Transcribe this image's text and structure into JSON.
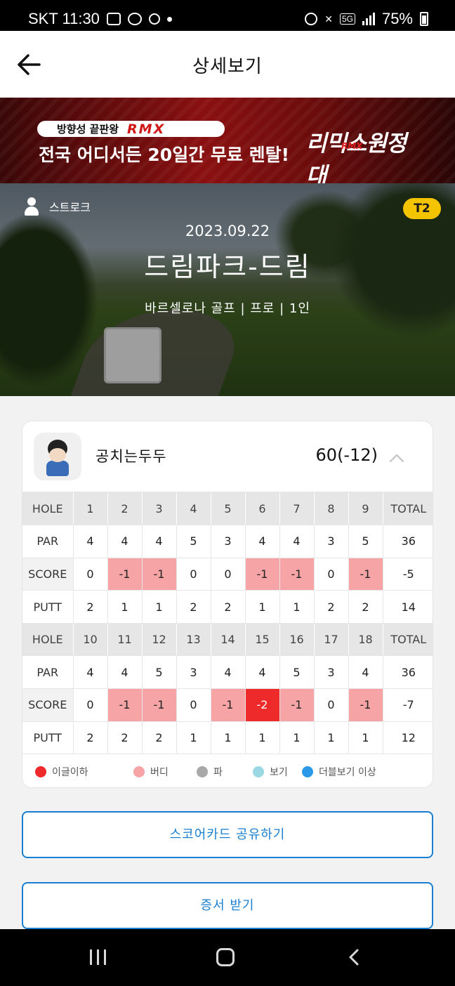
{
  "status_bar": {
    "carrier_time": "SKT 11:30",
    "network": "5G",
    "battery": "75%"
  },
  "header": {
    "title": "상세보기"
  },
  "banner": {
    "tag": "방향성 끝판왕",
    "brand": "RMX",
    "headline": "전국 어디서든 20일간 무료 렌탈!",
    "logo_text": "리믹스원정대",
    "logo_sub": "RMX"
  },
  "round": {
    "mode": "스트로크",
    "tee": "T2",
    "date": "2023.09.22",
    "course": "드림파크-드림",
    "meta": "바르셀로나 골프 | 프로 | 1인"
  },
  "player": {
    "name": "공치는두두",
    "total": "60(-12)"
  },
  "scorecard": {
    "front": {
      "hole_label": "HOLE",
      "holes": [
        "1",
        "2",
        "3",
        "4",
        "5",
        "6",
        "7",
        "8",
        "9"
      ],
      "total_label": "TOTAL",
      "par_label": "PAR",
      "par": [
        "4",
        "4",
        "4",
        "5",
        "3",
        "4",
        "4",
        "3",
        "5"
      ],
      "par_total": "36",
      "score_label": "SCORE",
      "score": [
        "0",
        "-1",
        "-1",
        "0",
        "0",
        "-1",
        "-1",
        "0",
        "-1"
      ],
      "score_total": "-5",
      "putt_label": "PUTT",
      "putt": [
        "2",
        "1",
        "1",
        "2",
        "2",
        "1",
        "1",
        "2",
        "2"
      ],
      "putt_total": "14"
    },
    "back": {
      "hole_label": "HOLE",
      "holes": [
        "10",
        "11",
        "12",
        "13",
        "14",
        "15",
        "16",
        "17",
        "18"
      ],
      "total_label": "TOTAL",
      "par_label": "PAR",
      "par": [
        "4",
        "4",
        "5",
        "3",
        "4",
        "4",
        "5",
        "3",
        "4"
      ],
      "par_total": "36",
      "score_label": "SCORE",
      "score": [
        "0",
        "-1",
        "-1",
        "0",
        "-1",
        "-2",
        "-1",
        "0",
        "-1"
      ],
      "score_total": "-7",
      "putt_label": "PUTT",
      "putt": [
        "2",
        "2",
        "2",
        "1",
        "1",
        "1",
        "1",
        "1",
        "1"
      ],
      "putt_total": "12"
    }
  },
  "legend": [
    {
      "label": "이글이하",
      "color": "#ee2a2a"
    },
    {
      "label": "버디",
      "color": "#f7a4a6"
    },
    {
      "label": "파",
      "color": "#a8a8a8"
    },
    {
      "label": "보기",
      "color": "#9ad8e4"
    },
    {
      "label": "더블보기 이상",
      "color": "#2a9ae8"
    }
  ],
  "actions": {
    "share_label": "스코어카드 공유하기",
    "cert_label": "증서 받기"
  },
  "colors": {
    "accent": "#1a7fd0",
    "birdie": "#f7a4a6",
    "eagle": "#ee2a2a",
    "tee_badge": "#f4c400"
  }
}
